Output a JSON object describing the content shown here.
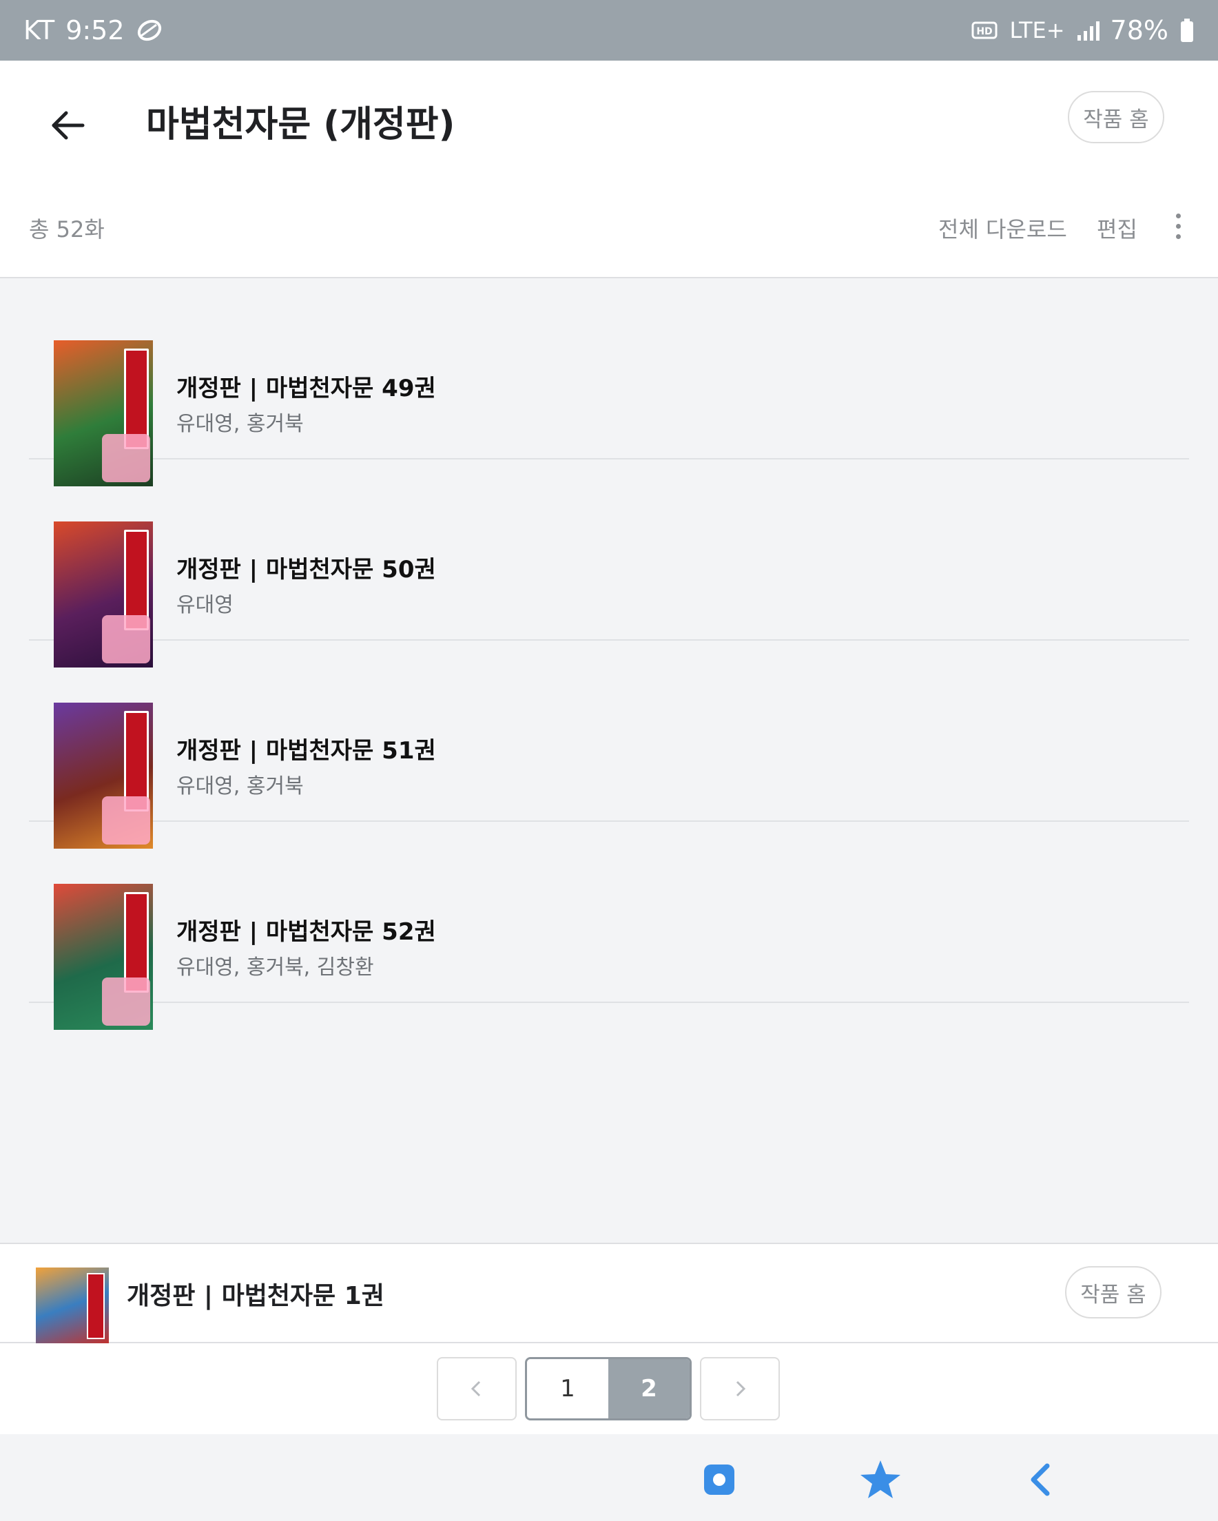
{
  "status_bar": {
    "carrier": "KT",
    "time": "9:52",
    "network": "LTE+",
    "battery": "78%",
    "hd_label": "HD"
  },
  "header": {
    "title": "마법천자문 (개정판)",
    "home_button": "작품 홈",
    "total_count": "총 52화",
    "download_all": "전체 다운로드",
    "edit": "편집"
  },
  "episodes": [
    {
      "title": "개정판 | 마법천자문 49권",
      "author": "유대영, 홍거북",
      "cover_color": "#2f7d3a"
    },
    {
      "title": "개정판 | 마법천자문 50권",
      "author": "유대영",
      "cover_color": "#5a1f5c"
    },
    {
      "title": "개정판 | 마법천자문 51권",
      "author": "유대영, 홍거북",
      "cover_color": "#7a2a1f"
    },
    {
      "title": "개정판 | 마법천자문 52권",
      "author": "유대영, 홍거북, 김창환",
      "cover_color": "#1f6a4a"
    }
  ],
  "mini_player": {
    "title": "개정판 | 마법천자문 1권",
    "home_button": "작품 홈"
  },
  "pagination": {
    "pages": [
      "1",
      "2"
    ],
    "current_page": "2"
  },
  "colors": {
    "status_bar": "#9aa3aa",
    "accent_blue": "#3a8ee6",
    "cover_red": "#c1121f"
  },
  "nav_icons": [
    "square-icon",
    "star-icon",
    "back-chevron-icon"
  ]
}
